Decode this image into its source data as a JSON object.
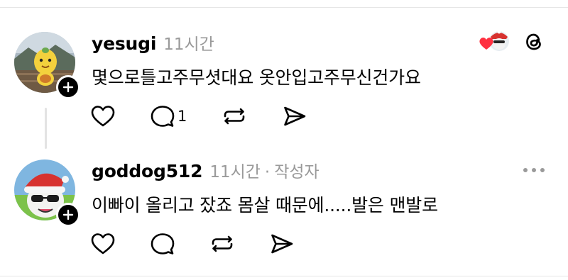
{
  "comments": [
    {
      "username": "yesugi",
      "time": "11시간",
      "text": "몇으로틀고주무셧대요 옷안입고주무신건가요",
      "reply_count": "1",
      "avatar_icon": "lemon-character-avatar",
      "has_liked_reaction": true
    },
    {
      "username": "goddog512",
      "time": "11시간",
      "separator": "·",
      "author_tag": "작성자",
      "text": "이빠이 올리고 잤죠 몸살 때문에.....발은 맨발로",
      "avatar_icon": "santa-hat-cat-avatar"
    }
  ],
  "icons": {
    "like": "heart-icon",
    "reply": "comment-icon",
    "repost": "repost-icon",
    "share": "send-icon",
    "app": "threads-logo-icon",
    "more": "more-dots-icon",
    "follow": "plus-icon"
  },
  "colors": {
    "like_red": "#ff3040",
    "meta_gray": "#9a9a9a"
  }
}
